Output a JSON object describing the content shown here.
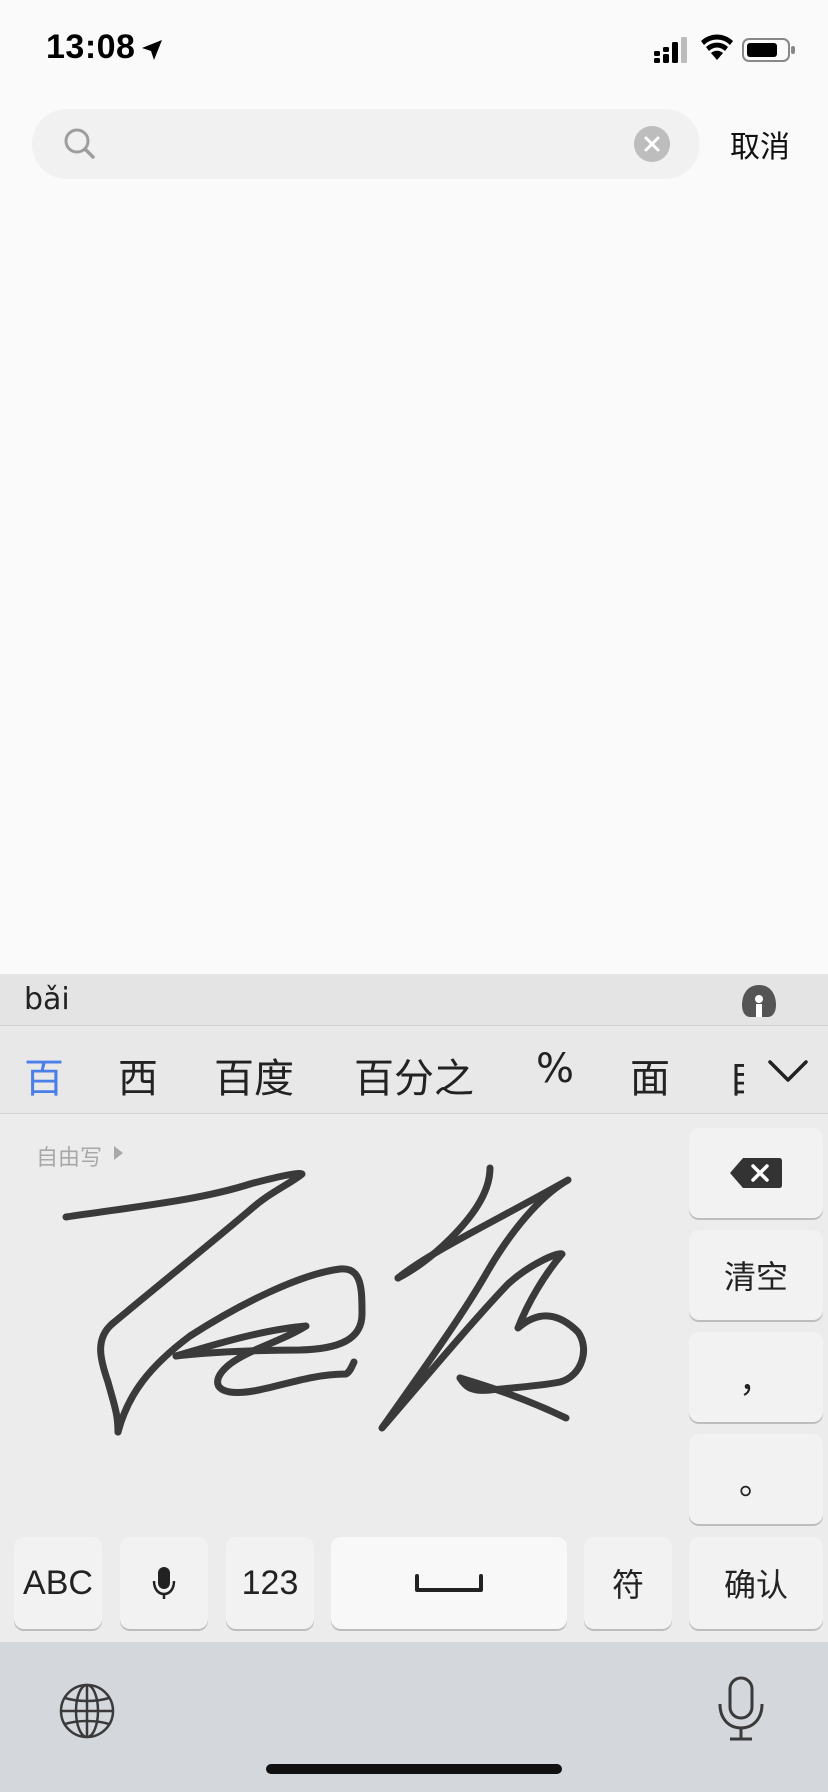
{
  "status_bar": {
    "time": "13:08",
    "icons": [
      "location-arrow-icon",
      "signal-icon",
      "wifi-icon",
      "battery-icon"
    ]
  },
  "search": {
    "value": "",
    "placeholder": "",
    "cancel_label": "取消",
    "icons": [
      "search-icon",
      "clear-icon"
    ]
  },
  "keyboard": {
    "pinyin": "bǎi",
    "candidates": [
      {
        "text": "百",
        "active": true
      },
      {
        "text": "西",
        "active": false
      },
      {
        "text": "百度",
        "active": false
      },
      {
        "text": "百分之",
        "active": false
      },
      {
        "text": "%",
        "active": false
      },
      {
        "text": "面",
        "active": false
      },
      {
        "text": "自",
        "active": false
      }
    ],
    "freewrite_label": "自由写",
    "side_keys": {
      "clear": "清空",
      "comma": "，",
      "period": "。"
    },
    "bottom_keys": {
      "abc": "ABC",
      "num": "123",
      "symbol": "符",
      "confirm": "确认"
    },
    "icons": [
      "assistant-icon",
      "chevron-down-icon",
      "backspace-icon",
      "microphone-icon",
      "space-icon",
      "globe-icon",
      "dictation-icon"
    ],
    "accent_color": "#4a7ee8"
  }
}
